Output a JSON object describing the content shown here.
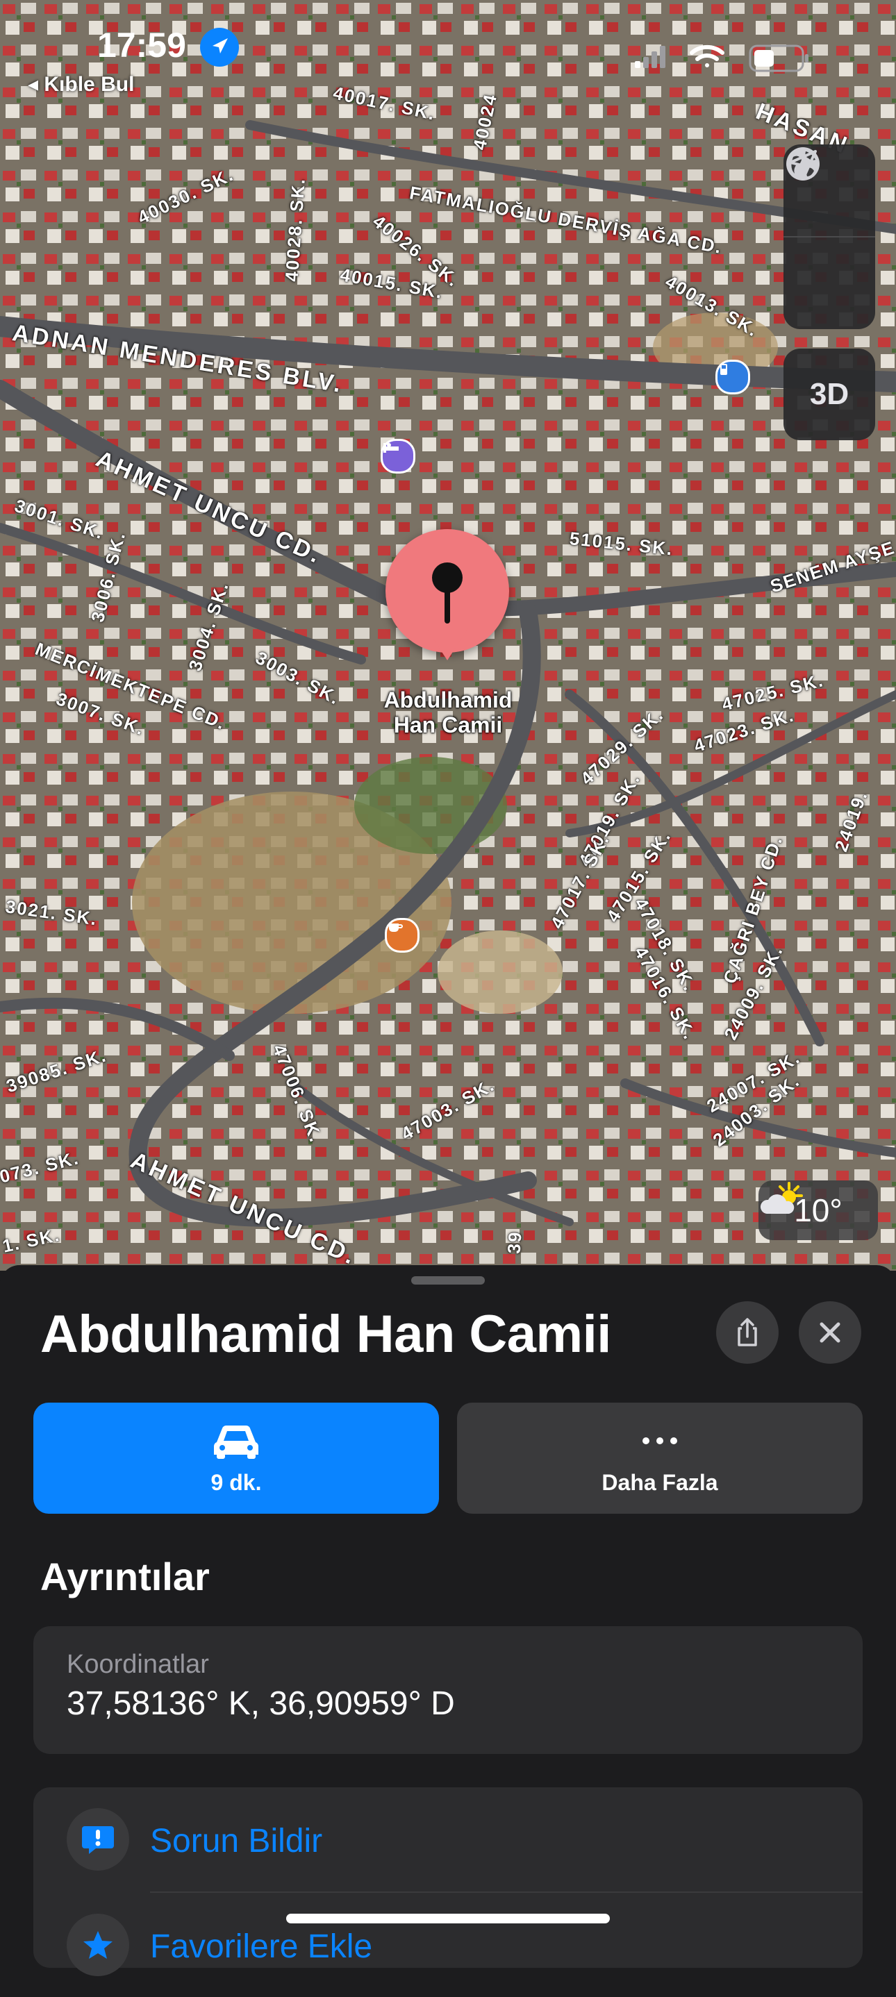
{
  "status_bar": {
    "time": "17:59",
    "back_app": "◂ Kıble Bul"
  },
  "map": {
    "controls": {
      "threed_label": "3D"
    },
    "weather": {
      "icon": "partly-sunny-icon",
      "temperature": "10°"
    },
    "pin_label_line1": "Abdulhamid",
    "pin_label_line2": "Han Camii",
    "streets": [
      "40017. SK.",
      "40024",
      "40030. SK.",
      "40028. SK.",
      "40026. SK.",
      "FATMALIOĞLU DERVİŞ AĞA CD.",
      "40015. SK.",
      "40013. SK.",
      "ADNAN MENDERES BLV.",
      "AHMET UNCU CD.",
      "3001. SK.",
      "3006. SK.",
      "51015. SK.",
      "SENEM AYŞE",
      "3004. SK.",
      "3003. SK.",
      "MERCİMEKTEPE CD.",
      "3007. SK.",
      "47025. SK.",
      "47023. SK.",
      "47029. SK.",
      "3021. SK.",
      "47019. SK.",
      "47017. SK.",
      "47015. SK.",
      "47018. SK.",
      "47016. SK.",
      "ÇAĞRI BEY CD.",
      "24009. SK.",
      "24019.",
      "24007. SK.",
      "24003. SK.",
      "39085. SK.",
      "47006. SK.",
      "47003. SK.",
      "073. SK.",
      "AHMET UNCU CD.",
      "1. SK.",
      "39",
      "HASAN"
    ]
  },
  "sheet": {
    "title": "Abdulhamid Han Camii",
    "directions_label": "9 dk.",
    "more_label": "Daha Fazla",
    "details_heading": "Ayrıntılar",
    "coordinates_label": "Koordinatlar",
    "coordinates_value": "37,58136° K, 36,90959° D",
    "report_issue": "Sorun Bildir",
    "add_favorites": "Favorilere Ekle"
  },
  "colors": {
    "accent": "#0a84ff",
    "pin": "#f0797d",
    "sheet_bg": "#1c1c1e",
    "card_bg": "#2c2c2e"
  }
}
